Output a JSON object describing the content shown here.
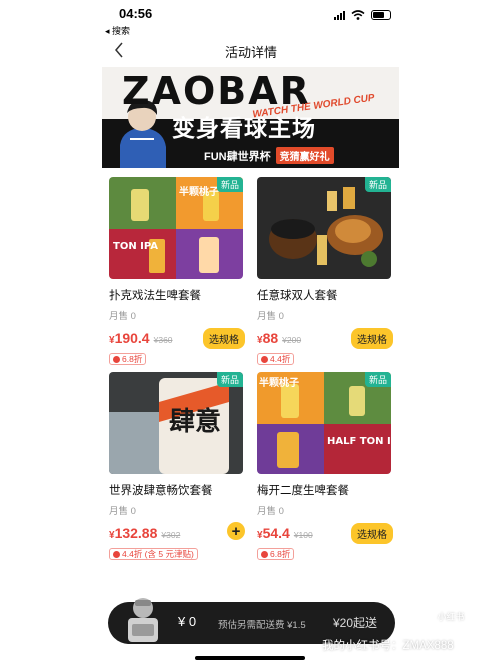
{
  "status_bar": {
    "time": "04:56",
    "back_app": "◂ 搜索"
  },
  "nav": {
    "title": "活动详情"
  },
  "banner": {
    "brand": "ZAOBAR",
    "subtitle": "WATCH THE WORLD CUP",
    "headline": "变身看球主场",
    "fun_line": "FUN肆世界杯",
    "tag": "竞猜赢好礼"
  },
  "products": [
    {
      "name": "扑克戏法生啤套餐",
      "sold": "月售 0",
      "currency": "¥",
      "price": "190.4",
      "original": "¥360",
      "discount": "6.8折",
      "badge": "新品",
      "action": "选规格",
      "action_type": "spec"
    },
    {
      "name": "任意球双人套餐",
      "sold": "月售 0",
      "currency": "¥",
      "price": "88",
      "original": "¥200",
      "discount": "4.4折",
      "badge": "新品",
      "action": "选规格",
      "action_type": "spec"
    },
    {
      "name": "世界波肆意畅饮套餐",
      "sold": "月售 0",
      "currency": "¥",
      "price": "132.88",
      "original": "¥302",
      "discount": "4.4折 (含 5 元津贴)",
      "badge": "新品",
      "action": "+",
      "action_type": "plus"
    },
    {
      "name": "梅开二度生啤套餐",
      "sold": "月售 0",
      "currency": "¥",
      "price": "54.4",
      "original": "¥100",
      "discount": "6.8折",
      "badge": "新品",
      "action": "选规格",
      "action_type": "spec"
    }
  ],
  "product_image_text": {
    "p1": {
      "top": "半颗桃子",
      "mid": "TON IPA"
    },
    "p2": {},
    "p3": {
      "can": "肆意"
    },
    "p4": {
      "top": "半颗桃子",
      "mid": "HALF TON IPA"
    }
  },
  "cart": {
    "price": "¥ 0",
    "fee": "预估另需配送费 ¥1.5",
    "min_order": "¥20起送"
  },
  "watermark": {
    "text": "我的小红书号：ZMAX888",
    "logo": "小红书"
  },
  "colors": {
    "accent": "#fcc52a",
    "price": "#e8453c",
    "badge": "#23b393"
  }
}
